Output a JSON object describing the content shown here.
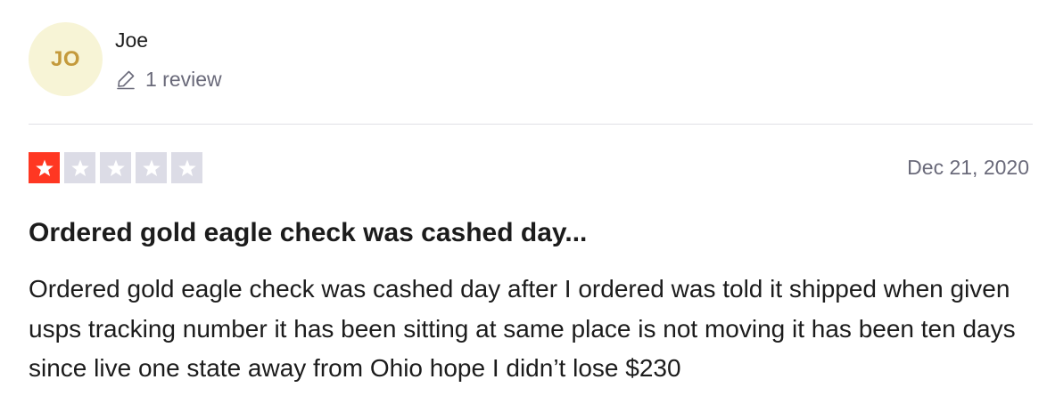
{
  "consumer": {
    "initials": "JO",
    "name": "Joe",
    "review_count": "1 review"
  },
  "review": {
    "rating": 1,
    "max_rating": 5,
    "date": "Dec 21, 2020",
    "title": "Ordered gold eagle check was cashed day...",
    "body": "Ordered gold eagle check was cashed day after I ordered was told it shipped when given usps tracking number it has been sitting at same place is not moving it has been ten days since live one state away from Ohio hope I didn’t lose $230"
  },
  "icons": {
    "review_count_icon": "pencil-icon",
    "rating_icon": "star-icon"
  },
  "colors": {
    "avatar_bg": "#f7f4d6",
    "avatar_text": "#c49a3c",
    "star_filled": "#ff3722",
    "star_empty": "#dcdce6",
    "muted_text": "#6a6a7a"
  }
}
